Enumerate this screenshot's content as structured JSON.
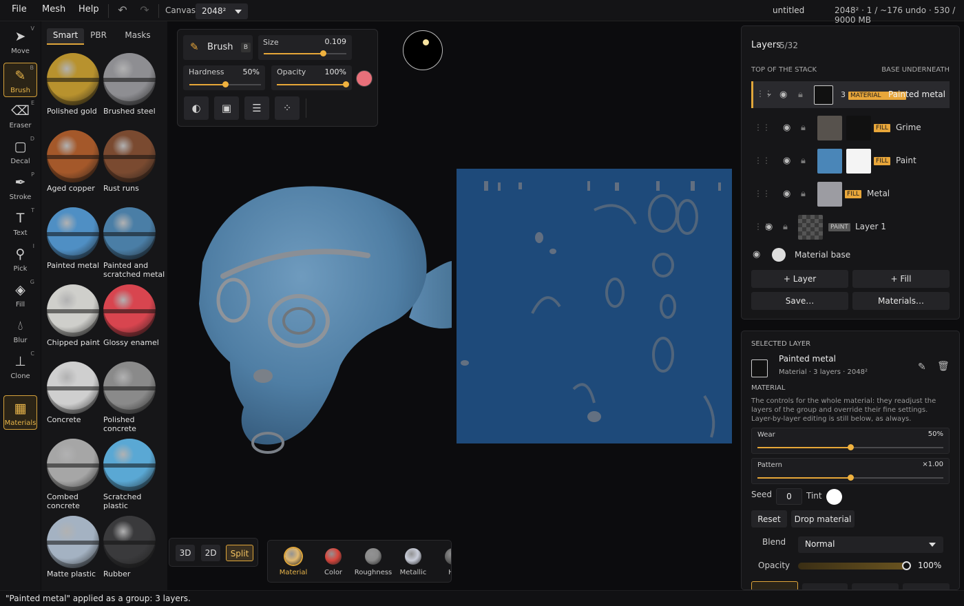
{
  "menu": {
    "file": "File",
    "mesh": "Mesh",
    "help": "Help"
  },
  "toolbar": {
    "canvas_label": "Canvas",
    "canvas_value": "2048²",
    "undo_icon": "undo-icon",
    "redo_icon": "redo-icon"
  },
  "doc": {
    "name": "untitled",
    "stats": "2048² · 1 / ~176 undo · 530 / 9000 MB"
  },
  "tools": [
    {
      "label": "Move",
      "key": "V",
      "icon": "cursor-icon"
    },
    {
      "label": "Brush",
      "key": "B",
      "icon": "brush-icon"
    },
    {
      "label": "Eraser",
      "key": "E",
      "icon": "eraser-icon"
    },
    {
      "label": "Decal",
      "key": "D",
      "icon": "decal-icon"
    },
    {
      "label": "Stroke",
      "key": "P",
      "icon": "pen-icon"
    },
    {
      "label": "Text",
      "key": "T",
      "icon": "text-icon"
    },
    {
      "label": "Pick",
      "key": "I",
      "icon": "eyedropper-icon"
    },
    {
      "label": "Fill",
      "key": "G",
      "icon": "bucket-icon"
    },
    {
      "label": "Blur",
      "key": "",
      "icon": "drop-icon"
    },
    {
      "label": "Clone",
      "key": "C",
      "icon": "stamp-icon"
    },
    {
      "label": "Materials",
      "key": "",
      "icon": "grid-icon"
    }
  ],
  "library": {
    "tabs": [
      "Smart",
      "PBR",
      "Masks"
    ],
    "materials": [
      {
        "name": "Polished gold",
        "color": "#b8922e"
      },
      {
        "name": "Brushed steel",
        "color": "#8e8e92"
      },
      {
        "name": "Aged copper",
        "color": "#a4582a"
      },
      {
        "name": "Rust runs",
        "color": "#7a4a30"
      },
      {
        "name": "Painted metal",
        "color": "#4f8fc4"
      },
      {
        "name": "Painted and scratched metal",
        "color": "#4a7ea6"
      },
      {
        "name": "Chipped paint",
        "color": "#cfcfcb"
      },
      {
        "name": "Glossy enamel",
        "color": "#d8454f"
      },
      {
        "name": "Concrete",
        "color": "#cfcfcf"
      },
      {
        "name": "Polished concrete",
        "color": "#8a8a8a"
      },
      {
        "name": "Combed concrete",
        "color": "#a6a6a6"
      },
      {
        "name": "Scratched plastic",
        "color": "#5aa8d4"
      },
      {
        "name": "Matte plastic",
        "color": "#a4b2c2"
      },
      {
        "name": "Rubber",
        "color": "#3a3a3c"
      }
    ]
  },
  "brush": {
    "label": "Brush",
    "key": "B",
    "size_label": "Size",
    "size_value": "0.109",
    "size_frac": 0.72,
    "hardness_label": "Hardness",
    "hardness_value": "50%",
    "hardness_frac": 0.5,
    "opacity_label": "Opacity",
    "opacity_value": "100%",
    "opacity_frac": 1.0,
    "color": "#e8707a"
  },
  "view_modes": [
    "3D",
    "2D",
    "Split"
  ],
  "active_view": "Split",
  "channels": [
    {
      "label": "Material",
      "color": "#e0b870"
    },
    {
      "label": "Color",
      "color": "#d8453c"
    },
    {
      "label": "Roughness",
      "color": "#8a8a8a"
    },
    {
      "label": "Metallic",
      "color": "#c8ccd8"
    },
    {
      "label": "He",
      "color": "#666"
    }
  ],
  "layers": {
    "title": "Layers",
    "count": "5/32",
    "top_label": "TOP OF THE STACK",
    "bottom_label": "BASE UNDERNEATH",
    "group": {
      "count": "3",
      "tag": "MATERIAL",
      "name": "Painted metal"
    },
    "children": [
      {
        "tag": "FILL",
        "name": "Grime",
        "color": "#57524d"
      },
      {
        "tag": "FILL",
        "name": "Paint",
        "color": "#4a86b8"
      },
      {
        "tag": "FILL",
        "name": "Metal",
        "color": "#9c9ca2"
      }
    ],
    "paint_layer": {
      "tag": "PAINT",
      "name": "Layer 1"
    },
    "base": {
      "name": "Material base"
    },
    "buttons": {
      "add_layer": "+ Layer",
      "add_fill": "+ Fill",
      "save": "Save…",
      "materials": "Materials…"
    }
  },
  "selected": {
    "section_label": "SELECTED LAYER",
    "name": "Painted metal",
    "meta": "Material · 3 layers · 2048²",
    "material_label": "MATERIAL",
    "description": "The controls for the whole material: they readjust the layers of the group and override their fine settings. Layer-by-layer editing is still below, as always.",
    "wear_label": "Wear",
    "wear_value": "50%",
    "wear_frac": 0.5,
    "pattern_label": "Pattern",
    "pattern_value": "×1.00",
    "pattern_frac": 0.5,
    "seed_label": "Seed",
    "seed_value": "0",
    "tint_label": "Tint",
    "reset": "Reset",
    "drop": "Drop material",
    "blend_label": "Blend",
    "blend_value": "Normal",
    "opacity_label": "Opacity",
    "opacity_value": "100%"
  },
  "status": "\"Painted metal\" applied as a group: 3 layers."
}
